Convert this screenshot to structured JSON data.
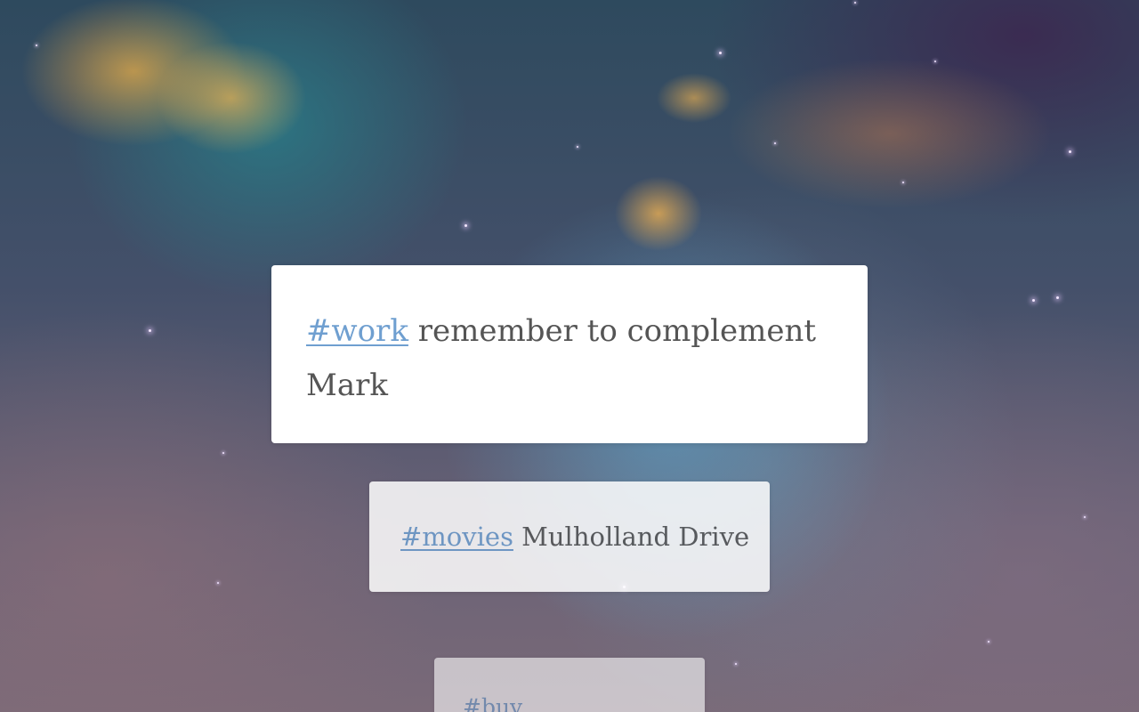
{
  "notes": [
    {
      "tag": "#work",
      "text": " remember to complement Mark"
    },
    {
      "tag": "#movies",
      "text": " Mulholland Drive"
    },
    {
      "tag": "#buy",
      "text": ""
    }
  ],
  "colors": {
    "tag": "#6f9fd0",
    "note_text": "#555555",
    "note_background": "#ffffff"
  }
}
